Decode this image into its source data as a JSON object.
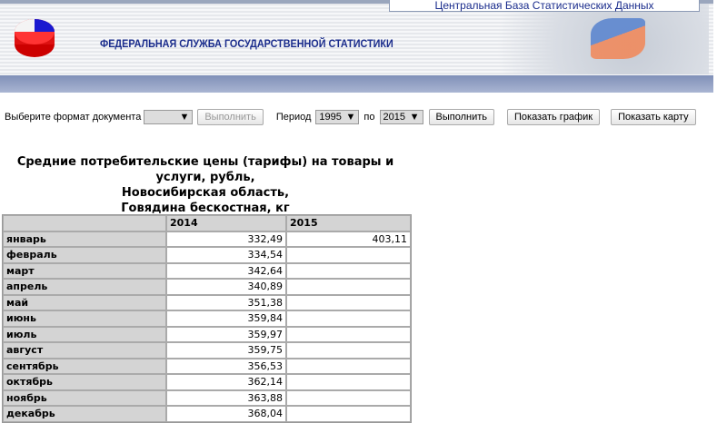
{
  "header": {
    "db_title": "Центральная База Статистических Данных",
    "org": "ФЕДЕРАЛЬНАЯ СЛУЖБА ГОСУДАРСТВЕННОЙ СТАТИСТИКИ"
  },
  "toolbar": {
    "format_label": "Выберите формат документа",
    "format_value": "",
    "run1": "Выполнить",
    "period_label": "Период",
    "from": "1995",
    "to_label": "по",
    "to": "2015",
    "run2": "Выполнить",
    "chart": "Показать график",
    "map": "Показать карту"
  },
  "report": {
    "title1": "Средние потребительские цены (тарифы) на товары и",
    "title2": "услуги, рубль,",
    "title3": "Новосибирская область,",
    "title4": "Говядина бескостная, кг"
  },
  "table": {
    "columns": [
      "",
      "2014",
      "2015"
    ],
    "rows": [
      [
        "январь",
        "332,49",
        "403,11"
      ],
      [
        "февраль",
        "334,54",
        ""
      ],
      [
        "март",
        "342,64",
        ""
      ],
      [
        "апрель",
        "340,89",
        ""
      ],
      [
        "май",
        "351,38",
        ""
      ],
      [
        "июнь",
        "359,84",
        ""
      ],
      [
        "июль",
        "359,97",
        ""
      ],
      [
        "август",
        "359,75",
        ""
      ],
      [
        "сентябрь",
        "356,53",
        ""
      ],
      [
        "октябрь",
        "362,14",
        ""
      ],
      [
        "ноябрь",
        "363,88",
        ""
      ],
      [
        "декабрь",
        "368,04",
        ""
      ]
    ]
  }
}
